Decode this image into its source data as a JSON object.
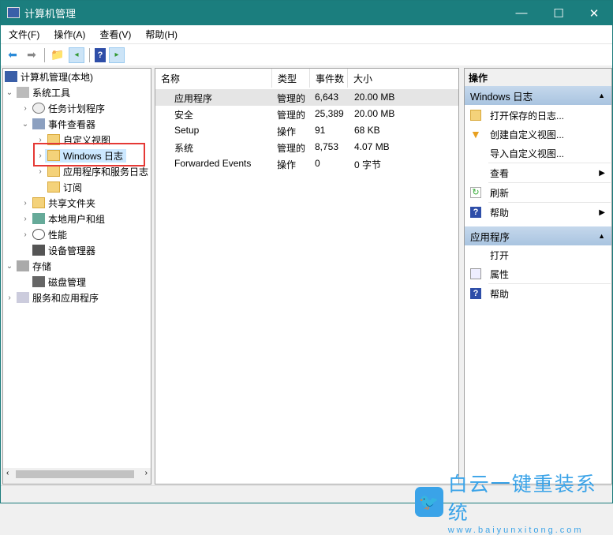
{
  "window": {
    "title": "计算机管理",
    "minimize": "—",
    "maximize": "☐",
    "close": "✕"
  },
  "menu": [
    "文件(F)",
    "操作(A)",
    "查看(V)",
    "帮助(H)"
  ],
  "tree": [
    {
      "label": "计算机管理(本地)",
      "arrow": ""
    },
    {
      "label": "系统工具",
      "arrow": "⌄"
    },
    {
      "label": "任务计划程序",
      "arrow": "›"
    },
    {
      "label": "事件查看器",
      "arrow": "⌄"
    },
    {
      "label": "自定义视图",
      "arrow": "›"
    },
    {
      "label": "Windows 日志",
      "arrow": "›"
    },
    {
      "label": "应用程序和服务日志",
      "arrow": "›"
    },
    {
      "label": "订阅",
      "arrow": ""
    },
    {
      "label": "共享文件夹",
      "arrow": "›"
    },
    {
      "label": "本地用户和组",
      "arrow": "›"
    },
    {
      "label": "性能",
      "arrow": "›"
    },
    {
      "label": "设备管理器",
      "arrow": ""
    },
    {
      "label": "存储",
      "arrow": "⌄"
    },
    {
      "label": "磁盘管理",
      "arrow": ""
    },
    {
      "label": "服务和应用程序",
      "arrow": "›"
    }
  ],
  "table": {
    "columns": [
      "名称",
      "类型",
      "事件数",
      "大小"
    ],
    "rows": [
      [
        "应用程序",
        "管理的",
        "6,643",
        "20.00 MB"
      ],
      [
        "安全",
        "管理的",
        "25,389",
        "20.00 MB"
      ],
      [
        "Setup",
        "操作",
        "91",
        "68 KB"
      ],
      [
        "系统",
        "管理的",
        "8,753",
        "4.07 MB"
      ],
      [
        "Forwarded Events",
        "操作",
        "0",
        "0 字节"
      ]
    ]
  },
  "actions": {
    "header": "操作",
    "section1": "Windows 日志",
    "items1": [
      "打开保存的日志...",
      "创建自定义视图...",
      "导入自定义视图...",
      "查看",
      "刷新",
      "帮助"
    ],
    "section2": "应用程序",
    "items2": [
      "打开",
      "属性",
      "帮助"
    ]
  },
  "watermark": {
    "name": "白云一键重装系统",
    "url": "www.baiyunxitong.com"
  },
  "colors": {
    "titlebar": "#1b7e7e",
    "selection": "#cce8ff",
    "highlight": "#e53935"
  }
}
